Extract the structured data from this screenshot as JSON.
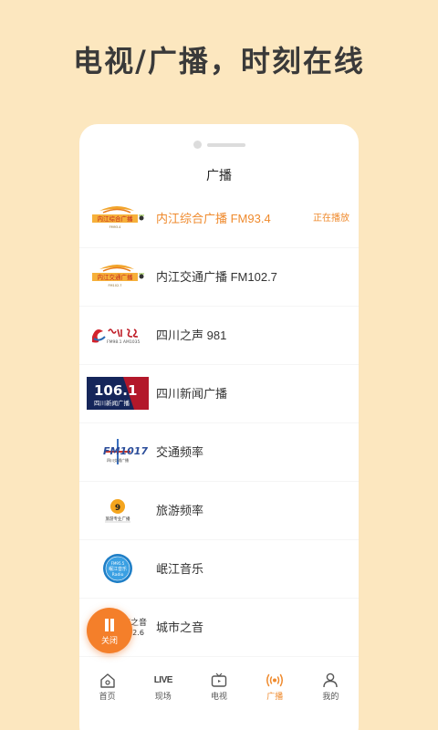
{
  "headline": "电视/广播，时刻在线",
  "page_title": "广播",
  "playing_label": "正在播放",
  "stations": [
    {
      "name": "内江综合广播 FM93.4",
      "logo": "neijiang-radio-logo",
      "active": true
    },
    {
      "name": "内江交通广播 FM102.7",
      "logo": "neijiang-radio-logo",
      "active": false
    },
    {
      "name": "四川之声 981",
      "logo": "sichuan-voice-logo",
      "active": false
    },
    {
      "name": "四川新闻广播",
      "logo": "sichuan-news-106-logo",
      "active": false
    },
    {
      "name": "交通频率",
      "logo": "fm1017-logo",
      "active": false
    },
    {
      "name": "旅游频率",
      "logo": "travel-radio-logo",
      "active": false
    },
    {
      "name": "岷江音乐",
      "logo": "minjiang-music-logo",
      "active": false
    },
    {
      "name": "城市之音",
      "logo": "city-voice-logo",
      "active": false
    }
  ],
  "logo_text": {
    "sichuan_news_freq": "106.1",
    "sichuan_news_sub": "四川新闻广播",
    "fm1017": "FM1017",
    "city_voice": "城市之音",
    "city_voice_freq": "102.6"
  },
  "float_button": {
    "label": "关闭",
    "icon": "pause-icon"
  },
  "tabs": [
    {
      "label": "首页",
      "icon": "home-icon",
      "active": false
    },
    {
      "label": "现场",
      "icon": "live-icon",
      "icon_text": "LIVE",
      "active": false
    },
    {
      "label": "电视",
      "icon": "tv-icon",
      "active": false
    },
    {
      "label": "广播",
      "icon": "broadcast-icon",
      "active": true
    },
    {
      "label": "我的",
      "icon": "user-icon",
      "active": false
    }
  ],
  "colors": {
    "accent": "#ef8a2d",
    "background": "#fce7bf"
  }
}
